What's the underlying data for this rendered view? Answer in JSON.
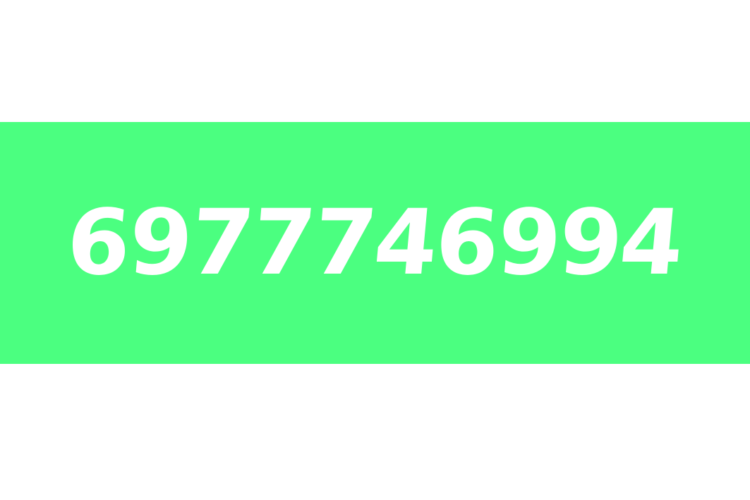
{
  "banner": {
    "number": "6977746994",
    "background_color": "#4BFF80",
    "text_color": "#FFFFFF"
  }
}
